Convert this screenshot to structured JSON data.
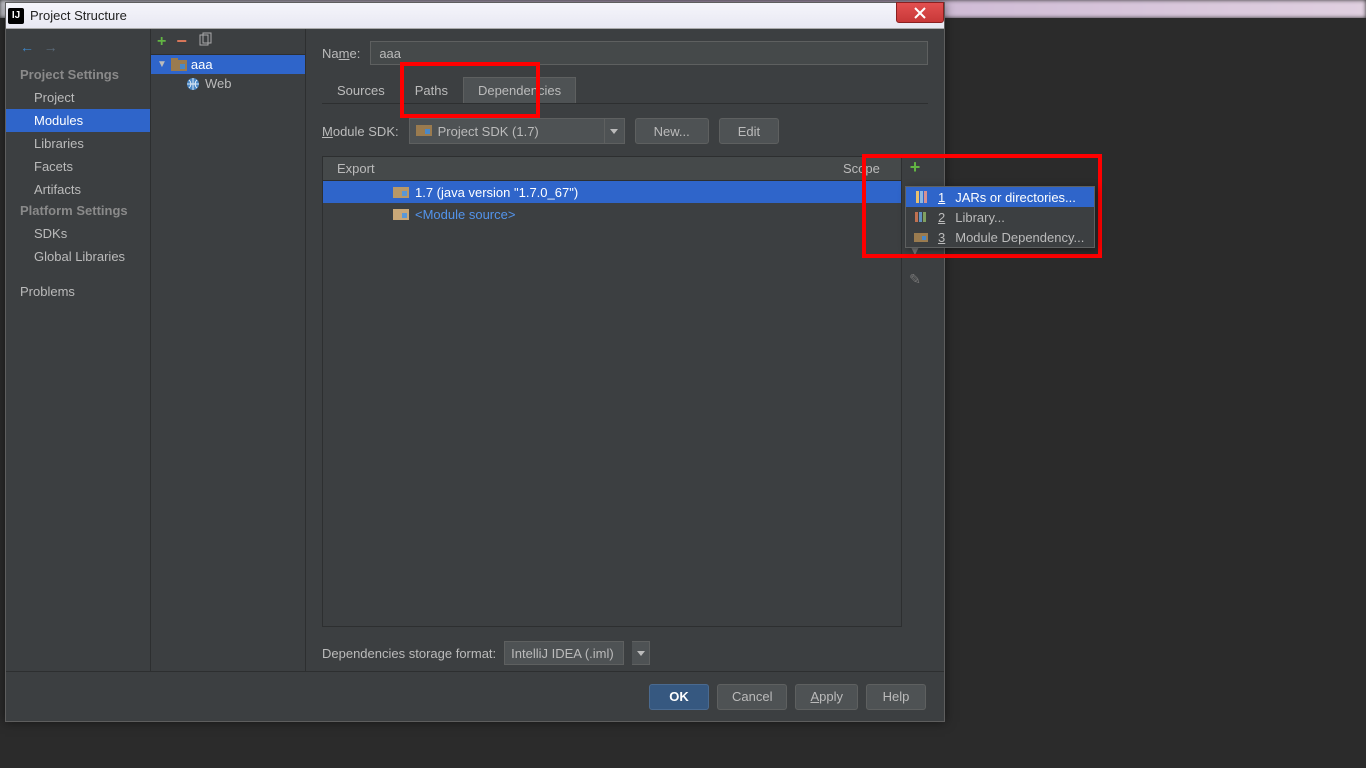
{
  "titlebar": {
    "title": "Project Structure"
  },
  "nav": {
    "project_settings": "Project Settings",
    "items_ps": [
      "Project",
      "Modules",
      "Libraries",
      "Facets",
      "Artifacts"
    ],
    "platform_settings": "Platform Settings",
    "items_pl": [
      "SDKs",
      "Global Libraries"
    ],
    "problems": "Problems"
  },
  "tree": {
    "root": "aaa",
    "child": "Web"
  },
  "main": {
    "name_label": "Name:",
    "name_value": "aaa",
    "tabs": [
      "Sources",
      "Paths",
      "Dependencies"
    ],
    "sdk_label": "Module SDK:",
    "sdk_value": "Project SDK (1.7)",
    "new_btn": "New...",
    "edit_btn": "Edit",
    "col_export": "Export",
    "col_scope": "Scope",
    "rows": [
      {
        "label": "1.7 (java version \"1.7.0_67\")",
        "selected": true
      },
      {
        "label": "<Module source>",
        "selected": false,
        "module": true
      }
    ],
    "storage_label": "Dependencies storage format:",
    "storage_value": "IntelliJ IDEA (.iml)"
  },
  "popup": {
    "items": [
      {
        "key": "1",
        "label": "JARs or directories...",
        "selected": true
      },
      {
        "key": "2",
        "label": "Library...",
        "selected": false
      },
      {
        "key": "3",
        "label": "Module Dependency...",
        "selected": false
      }
    ]
  },
  "footer": {
    "ok": "OK",
    "cancel": "Cancel",
    "apply": "Apply",
    "help": "Help"
  }
}
